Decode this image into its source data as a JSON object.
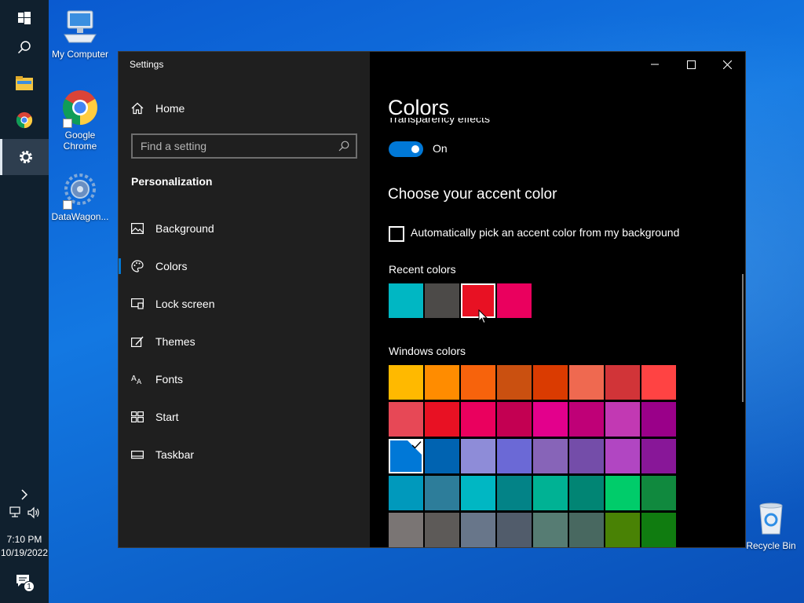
{
  "desktop": {
    "icons": [
      {
        "label": "My Computer"
      },
      {
        "label_line1": "Google",
        "label_line2": "Chrome"
      },
      {
        "label": "DataWagon..."
      },
      {
        "label": "Recycle Bin"
      }
    ]
  },
  "taskbar": {
    "time": "7:10 PM",
    "date": "10/19/2022",
    "notification_count": "1"
  },
  "window": {
    "title": "Settings",
    "nav": {
      "home_label": "Home",
      "search_placeholder": "Find a setting",
      "section": "Personalization",
      "items": [
        {
          "label": "Background",
          "icon": "picture-icon"
        },
        {
          "label": "Colors",
          "icon": "palette-icon"
        },
        {
          "label": "Lock screen",
          "icon": "lock-screen-icon"
        },
        {
          "label": "Themes",
          "icon": "themes-icon"
        },
        {
          "label": "Fonts",
          "icon": "fonts-icon"
        },
        {
          "label": "Start",
          "icon": "start-icon"
        },
        {
          "label": "Taskbar",
          "icon": "taskbar-icon"
        }
      ],
      "selected": "Colors"
    },
    "main": {
      "title": "Colors",
      "transparency_label_clipped": "Transparency effects",
      "transparency_state": "On",
      "accent_heading": "Choose your accent color",
      "auto_pick_label": "Automatically pick an accent color from my background",
      "recent_colors_label": "Recent colors",
      "recent_colors": [
        "#00b7c3",
        "#4c4a48",
        "#e81123",
        "#ea005e"
      ],
      "windows_colors_label": "Windows colors",
      "windows_colors": [
        [
          "#ffb900",
          "#ff8c00",
          "#f7630c",
          "#ca5010",
          "#da3b01",
          "#ef6950",
          "#d13438",
          "#ff4343"
        ],
        [
          "#e74856",
          "#e81123",
          "#ea005e",
          "#c30052",
          "#e3008c",
          "#bf0077",
          "#c239b3",
          "#9a0089"
        ],
        [
          "#0078d7",
          "#0063b1",
          "#8e8cd8",
          "#6b69d6",
          "#8764b8",
          "#744da9",
          "#b146c2",
          "#881798"
        ],
        [
          "#0099bc",
          "#2d7d9a",
          "#00b7c3",
          "#038387",
          "#00b294",
          "#018574",
          "#00cc6a",
          "#10893e"
        ],
        [
          "#7a7574",
          "#5d5a58",
          "#68768a",
          "#515c6b",
          "#567c73",
          "#486860",
          "#498205",
          "#107c10"
        ]
      ]
    }
  },
  "colors": {
    "accent": "#0078d7",
    "nav_bg": "#1f1f1f",
    "content_bg": "#000000"
  }
}
